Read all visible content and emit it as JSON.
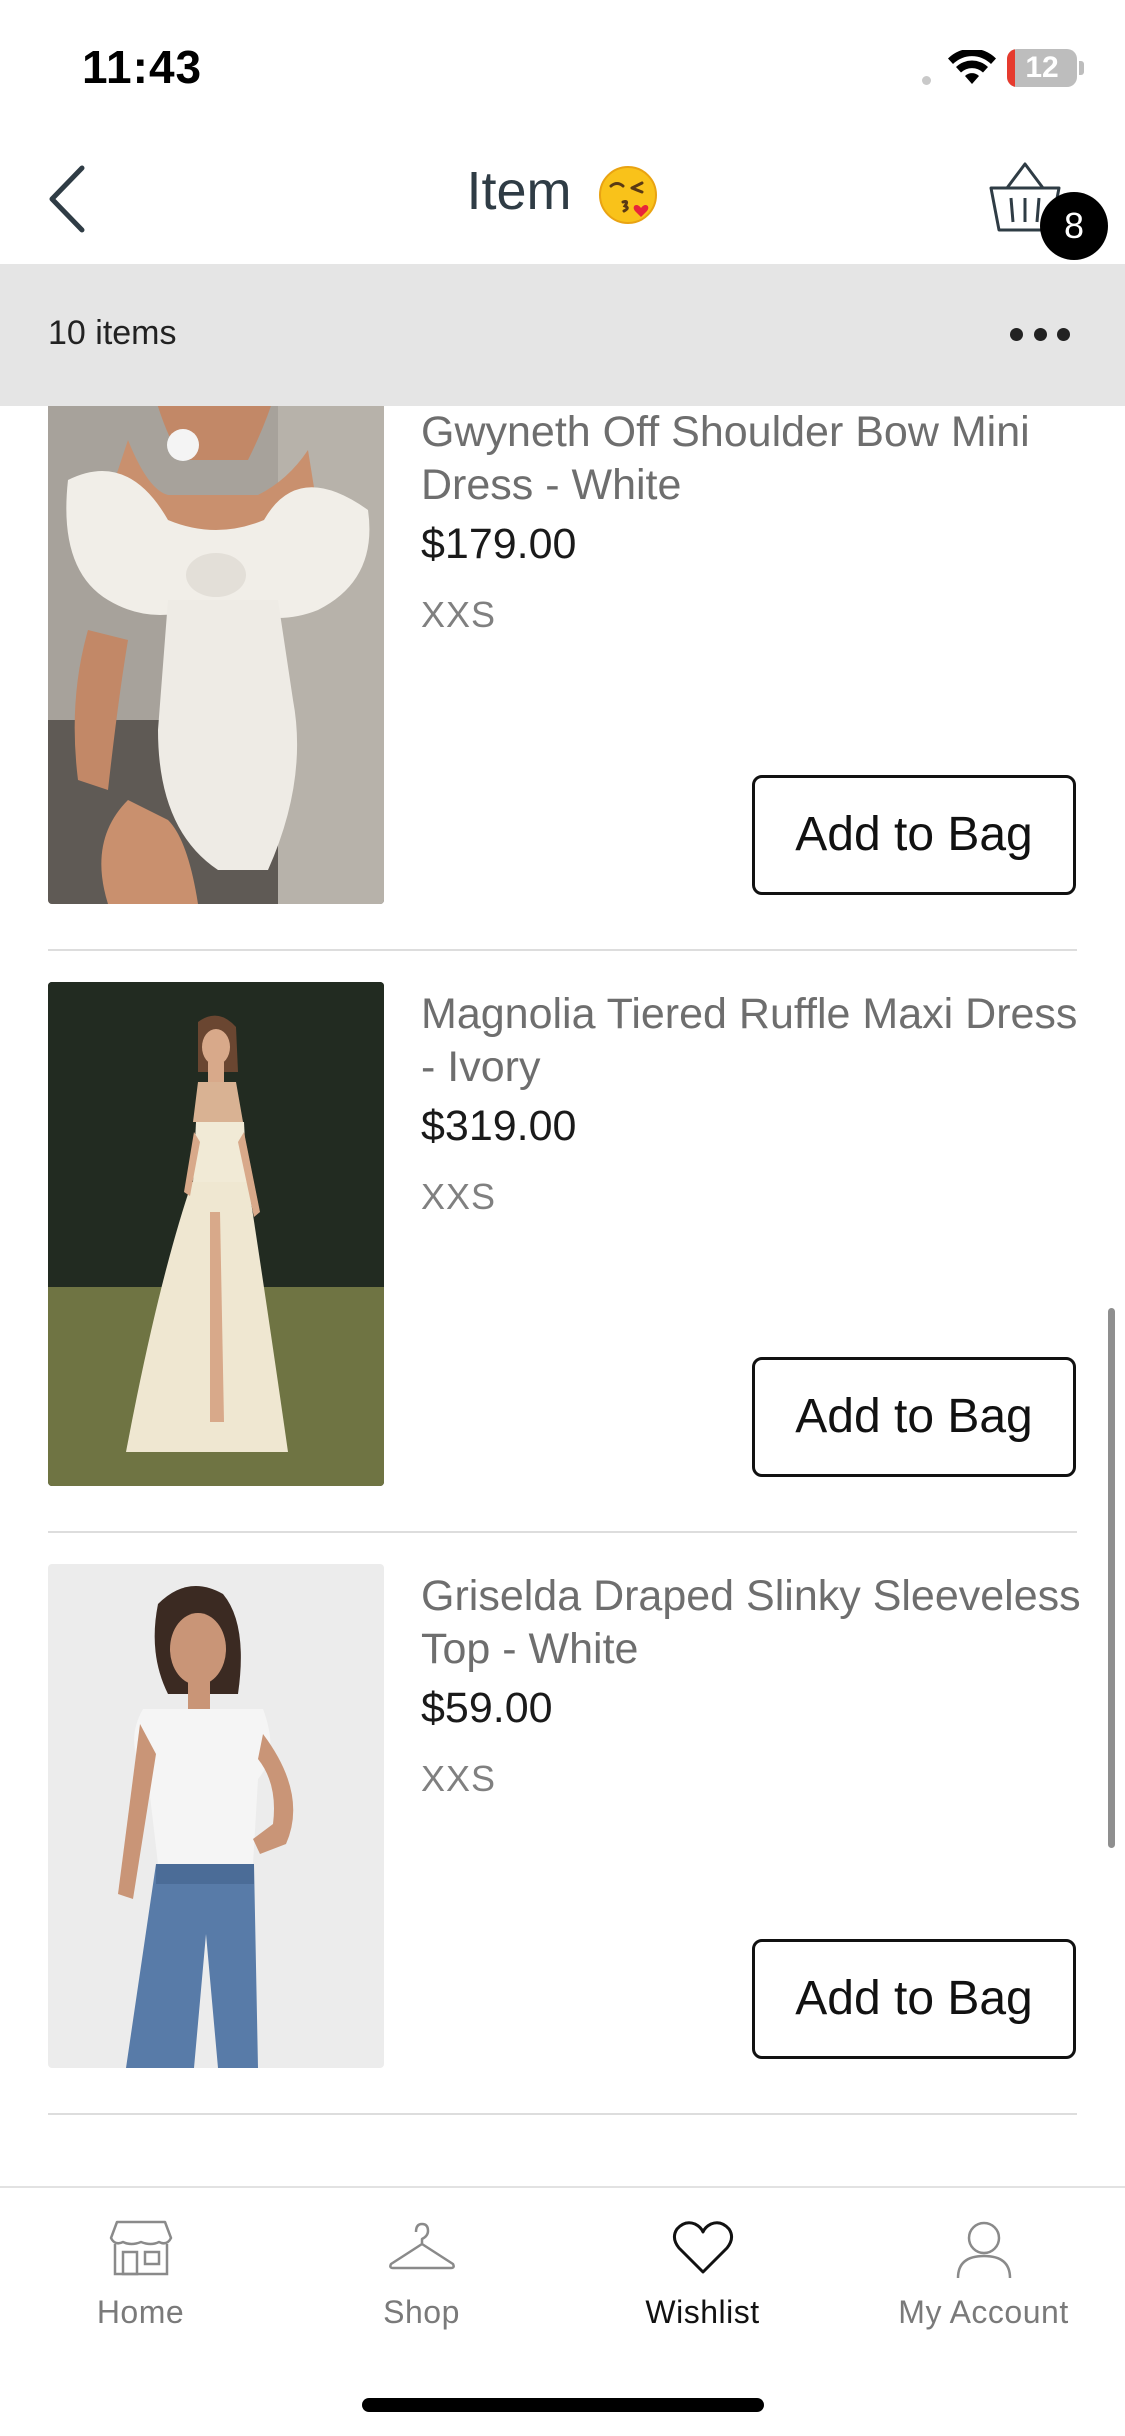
{
  "status_bar": {
    "time": "11:43",
    "battery": "12",
    "battery_level": 0.12
  },
  "nav": {
    "title": "Item",
    "title_emoji": "face-blowing-kiss-emoji",
    "cart_count": "8",
    "back_icon": "chevron-left-icon",
    "cart_icon": "basket-icon"
  },
  "toolbar": {
    "item_count": "10 items",
    "more_icon": "ellipsis-icon"
  },
  "products": [
    {
      "name": "Gwyneth Off Shoulder Bow Mini Dress - White",
      "price": "$179.00",
      "size": "XXS",
      "button": "Add to Bag",
      "image": "model-white-mini-dress-photo"
    },
    {
      "name": "Magnolia Tiered Ruffle Maxi Dress - Ivory",
      "price": "$319.00",
      "size": "XXS",
      "button": "Add to Bag",
      "image": "model-ivory-ruffle-maxi-dress-photo"
    },
    {
      "name": "Griselda Draped Slinky Sleeveless Top - White",
      "price": "$59.00",
      "size": "XXS",
      "button": "Add to Bag",
      "image": "model-white-top-jeans-photo"
    }
  ],
  "tabs": [
    {
      "label": "Home",
      "icon": "storefront-icon",
      "active": false
    },
    {
      "label": "Shop",
      "icon": "hanger-icon",
      "active": false
    },
    {
      "label": "Wishlist",
      "icon": "heart-icon",
      "active": true
    },
    {
      "label": "My Account",
      "icon": "person-icon",
      "active": false
    }
  ]
}
